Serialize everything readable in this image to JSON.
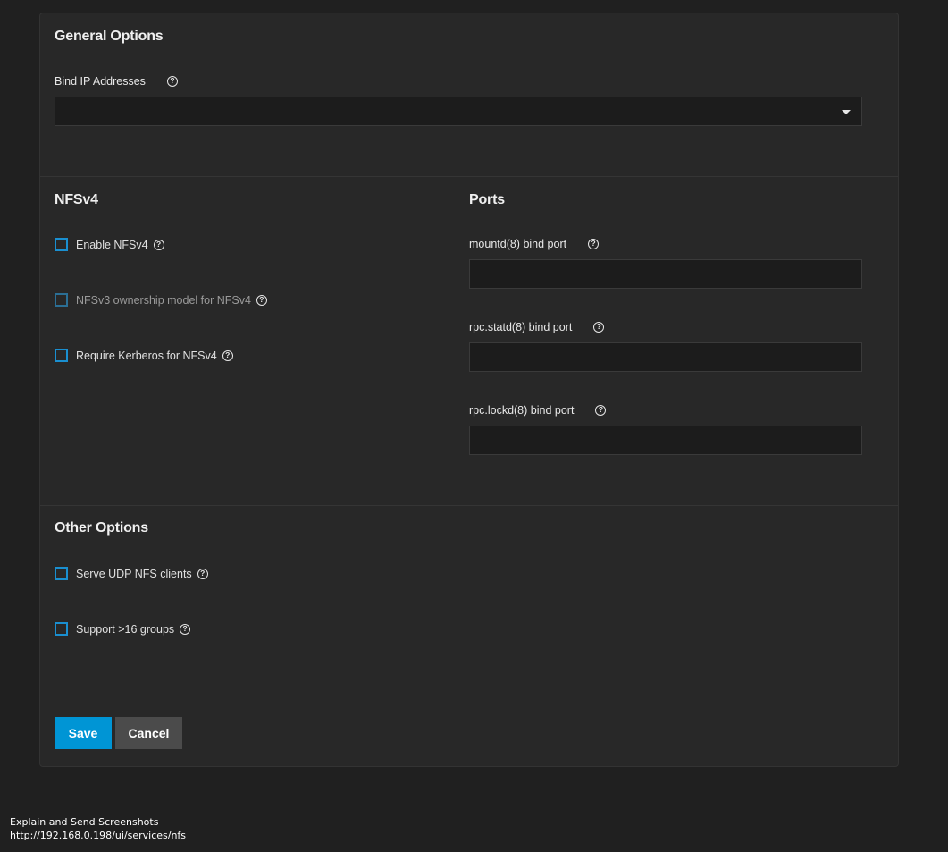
{
  "general": {
    "heading": "General Options",
    "bind_ip_label": "Bind IP Addresses",
    "bind_ip_value": ""
  },
  "nfsv4": {
    "heading": "NFSv4",
    "enable_label": "Enable NFSv4",
    "ownership_label": "NFSv3 ownership model for NFSv4",
    "kerberos_label": "Require Kerberos for NFSv4"
  },
  "ports": {
    "heading": "Ports",
    "mountd_label": "mountd(8) bind port",
    "mountd_value": "",
    "statd_label": "rpc.statd(8) bind port",
    "statd_value": "",
    "lockd_label": "rpc.lockd(8) bind port",
    "lockd_value": ""
  },
  "other": {
    "heading": "Other Options",
    "udp_label": "Serve UDP NFS clients",
    "groups_label": "Support >16 groups"
  },
  "actions": {
    "save_label": "Save",
    "cancel_label": "Cancel"
  },
  "footer": {
    "line1": "Explain and Send Screenshots",
    "line2": "http://192.168.0.198/ui/services/nfs"
  },
  "icons": {
    "help": "help-circle-icon",
    "dropdown": "dropdown-arrow-icon"
  },
  "colors": {
    "accent": "#0095d5",
    "checkbox_border": "#1a8fd0",
    "card_bg": "#282828",
    "page_bg": "#202020"
  }
}
